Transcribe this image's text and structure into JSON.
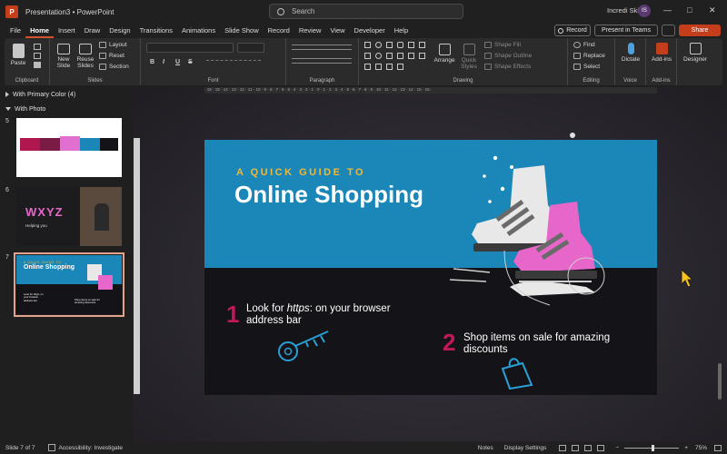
{
  "titlebar": {
    "app_logo": "P",
    "title": "Presentation3  •  PowerPoint",
    "search_placeholder": "Search",
    "user_name": "Incredi Skill",
    "user_initials": "IS",
    "minimize_icon": "—",
    "maximize_icon": "□",
    "close_icon": "✕"
  },
  "menu": {
    "tabs": [
      "File",
      "Home",
      "Insert",
      "Draw",
      "Design",
      "Transitions",
      "Animations",
      "Slide Show",
      "Record",
      "Review",
      "View",
      "Developer",
      "Help"
    ],
    "active": "Home",
    "record_label": "Record",
    "present_teams_label": "Present in Teams",
    "share_label": "Share"
  },
  "ribbon": {
    "clipboard": {
      "paste": "Paste",
      "label": "Clipboard"
    },
    "slides": {
      "new_slide": "New Slide",
      "reuse_slides": "Reuse Slides",
      "layout": "Layout",
      "reset": "Reset",
      "section": "Section",
      "label": "Slides"
    },
    "font": {
      "label": "Font",
      "bold": "B",
      "italic": "I",
      "underline": "U",
      "strike": "S"
    },
    "paragraph": {
      "label": "Paragraph"
    },
    "drawing": {
      "arrange": "Arrange",
      "quick_styles": "Quick Styles",
      "shape_fill": "Shape Fill",
      "shape_outline": "Shape Outline",
      "shape_effects": "Shape Effects",
      "label": "Drawing"
    },
    "editing": {
      "find": "Find",
      "replace": "Replace",
      "select": "Select",
      "label": "Editing"
    },
    "voice": {
      "dictate": "Dictate",
      "label": "Voice"
    },
    "addins": {
      "addins": "Add-ins",
      "label": "Add-ins"
    },
    "designer": {
      "designer": "Designer"
    }
  },
  "ruler": {
    "ticks": "· 16 · 15 · 14 · 13 · 12 · 11 · 10 · 9 · 8 · 7 · 6 · 5 · 4 · 3 · 2 · 1 · 0 · 1 · 2 · 3 · 4 · 5 · 6 · 7 · 8 · 9 · 10 · 11 · 12 · 13 · 14 · 15 · 16 ·"
  },
  "thumbnails": {
    "section1": "With Primary Color (4)",
    "section2": "With Photo",
    "slides": [
      {
        "number": "5"
      },
      {
        "number": "6",
        "title": "WXYZ",
        "subtitle": "Helping you"
      },
      {
        "number": "7",
        "subtitle": "A QUICK GUIDE TO",
        "title": "Online Shopping",
        "item1": "Look for https: on your browser address bar",
        "item2": "Shop items on sale for amazing discounts"
      }
    ]
  },
  "slide": {
    "subtitle": "A QUICK GUIDE TO",
    "title": "Online Shopping",
    "item1_number": "1",
    "item1_prefix": "Look for ",
    "item1_emphasis": "https",
    "item1_suffix": ": on your browser",
    "item1_line2": "address bar",
    "item2_number": "2",
    "item2_line1": "Shop items on sale for amazing",
    "item2_line2": "discounts",
    "colors": {
      "top": "#1a87b8",
      "bottom": "#141418",
      "accent_number": "#c2185b",
      "subtitle": "#f0b83a",
      "skate_pink": "#e667c9"
    }
  },
  "status": {
    "slide_count": "Slide 7 of 7",
    "accessibility": "Accessibility: Investigate",
    "notes": "Notes",
    "display_settings": "Display Settings",
    "zoom": "75%"
  }
}
